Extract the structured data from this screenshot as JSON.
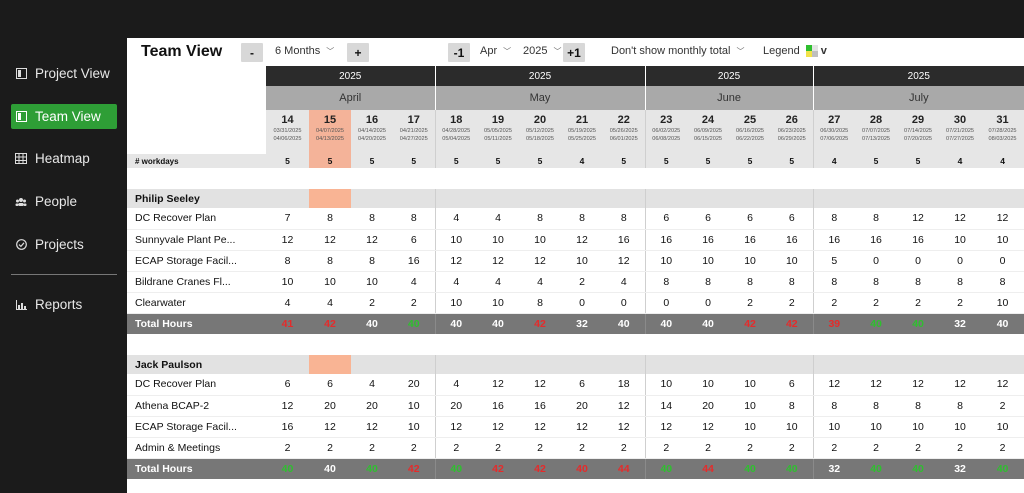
{
  "sidebar": {
    "items": [
      {
        "label": "Project View",
        "icon": "project-icon",
        "active": false
      },
      {
        "label": "Team View",
        "icon": "team-icon",
        "active": true
      },
      {
        "label": "Heatmap",
        "icon": "heatmap-icon",
        "active": false
      },
      {
        "label": "People",
        "icon": "people-icon",
        "active": false
      },
      {
        "label": "Projects",
        "icon": "projects-check-icon",
        "active": false
      },
      {
        "label": "Reports",
        "icon": "chart-icon",
        "active": false
      }
    ]
  },
  "header": {
    "title": "Team View",
    "minus_label": "-",
    "plus_label": "+",
    "range_value": "6 Months",
    "prev_label": "-1",
    "next_label": "+1",
    "month_value": "Apr",
    "year_value": "2025",
    "monthly_total_value": "Don't show monthly total",
    "legend_label": "Legend",
    "legend_chevron": "v",
    "legend_colors": [
      "#2fbf2f",
      "#e3e3e3",
      "#f2e24a",
      "#bfbfbf"
    ]
  },
  "grid": {
    "years": [
      {
        "label": "2025",
        "span": 4
      },
      {
        "label": "2025",
        "span": 5
      },
      {
        "label": "2025",
        "span": 4
      },
      {
        "label": "2025",
        "span": 5
      }
    ],
    "months": [
      {
        "label": "April",
        "span": 4
      },
      {
        "label": "May",
        "span": 5
      },
      {
        "label": "June",
        "span": 4
      },
      {
        "label": "July",
        "span": 5
      }
    ],
    "weeks": [
      {
        "num": "14",
        "start": "03/31/2025",
        "end": "04/06/2025"
      },
      {
        "num": "15",
        "start": "04/07/2025",
        "end": "04/13/2025"
      },
      {
        "num": "16",
        "start": "04/14/2025",
        "end": "04/20/2025"
      },
      {
        "num": "17",
        "start": "04/21/2025",
        "end": "04/27/2025"
      },
      {
        "num": "18",
        "start": "04/28/2025",
        "end": "05/04/2025"
      },
      {
        "num": "19",
        "start": "05/05/2025",
        "end": "05/11/2025"
      },
      {
        "num": "20",
        "start": "05/12/2025",
        "end": "05/18/2025"
      },
      {
        "num": "21",
        "start": "05/19/2025",
        "end": "05/25/2025"
      },
      {
        "num": "22",
        "start": "05/26/2025",
        "end": "06/01/2025"
      },
      {
        "num": "23",
        "start": "06/02/2025",
        "end": "06/08/2025"
      },
      {
        "num": "24",
        "start": "06/09/2025",
        "end": "06/15/2025"
      },
      {
        "num": "25",
        "start": "06/16/2025",
        "end": "06/22/2025"
      },
      {
        "num": "26",
        "start": "06/23/2025",
        "end": "06/29/2025"
      },
      {
        "num": "27",
        "start": "06/30/2025",
        "end": "07/06/2025"
      },
      {
        "num": "28",
        "start": "07/07/2025",
        "end": "07/13/2025"
      },
      {
        "num": "29",
        "start": "07/14/2025",
        "end": "07/20/2025"
      },
      {
        "num": "30",
        "start": "07/21/2025",
        "end": "07/27/2025"
      },
      {
        "num": "31",
        "start": "07/28/2025",
        "end": "08/03/2025"
      }
    ],
    "current_week_index": 1,
    "workdays_label": "# workdays",
    "workdays": [
      "5",
      "5",
      "5",
      "5",
      "5",
      "5",
      "5",
      "4",
      "5",
      "5",
      "5",
      "5",
      "5",
      "4",
      "5",
      "5",
      "4",
      "4"
    ],
    "total_label": "Total Hours",
    "people": [
      {
        "name": "Philip Seeley",
        "projects": [
          {
            "name": "DC Recover Plan",
            "hours": [
              "7",
              "8",
              "8",
              "8",
              "4",
              "4",
              "8",
              "8",
              "8",
              "6",
              "6",
              "6",
              "6",
              "8",
              "8",
              "12",
              "12",
              "12"
            ]
          },
          {
            "name": "Sunnyvale Plant Pe...",
            "hours": [
              "12",
              "12",
              "12",
              "6",
              "10",
              "10",
              "10",
              "12",
              "16",
              "16",
              "16",
              "16",
              "16",
              "16",
              "16",
              "16",
              "10",
              "10"
            ]
          },
          {
            "name": "ECAP Storage Facil...",
            "hours": [
              "8",
              "8",
              "8",
              "16",
              "12",
              "12",
              "12",
              "10",
              "12",
              "10",
              "10",
              "10",
              "10",
              "5",
              "0",
              "0",
              "0",
              "0"
            ]
          },
          {
            "name": "Bildrane Cranes Fl...",
            "hours": [
              "10",
              "10",
              "10",
              "4",
              "4",
              "4",
              "4",
              "2",
              "4",
              "8",
              "8",
              "8",
              "8",
              "8",
              "8",
              "8",
              "8",
              "8"
            ]
          },
          {
            "name": "Clearwater",
            "hours": [
              "4",
              "4",
              "2",
              "2",
              "10",
              "10",
              "8",
              "0",
              "0",
              "0",
              "0",
              "2",
              "2",
              "2",
              "2",
              "2",
              "2",
              "10"
            ]
          }
        ],
        "totals": [
          "41",
          "42",
          "40",
          "40",
          "40",
          "40",
          "42",
          "32",
          "40",
          "40",
          "40",
          "42",
          "42",
          "39",
          "40",
          "40",
          "32",
          "40"
        ],
        "total_status": [
          "red",
          "red",
          "normal",
          "green",
          "normal",
          "normal",
          "red",
          "normal",
          "normal",
          "normal",
          "normal",
          "red",
          "red",
          "red",
          "green",
          "green",
          "normal",
          "normal"
        ]
      },
      {
        "name": "Jack Paulson",
        "projects": [
          {
            "name": "DC Recover Plan",
            "hours": [
              "6",
              "6",
              "4",
              "20",
              "4",
              "12",
              "12",
              "6",
              "18",
              "10",
              "10",
              "10",
              "6",
              "12",
              "12",
              "12",
              "12",
              "12"
            ]
          },
          {
            "name": "Athena BCAP-2",
            "hours": [
              "12",
              "20",
              "20",
              "10",
              "20",
              "16",
              "16",
              "20",
              "12",
              "14",
              "20",
              "10",
              "8",
              "8",
              "8",
              "8",
              "8",
              "2"
            ]
          },
          {
            "name": "ECAP Storage Facil...",
            "hours": [
              "16",
              "12",
              "12",
              "10",
              "12",
              "12",
              "12",
              "12",
              "12",
              "12",
              "12",
              "10",
              "10",
              "10",
              "10",
              "10",
              "10",
              "10"
            ]
          },
          {
            "name": "Admin & Meetings",
            "hours": [
              "2",
              "2",
              "2",
              "2",
              "2",
              "2",
              "2",
              "2",
              "2",
              "2",
              "2",
              "2",
              "2",
              "2",
              "2",
              "2",
              "2",
              "2"
            ]
          }
        ],
        "totals": [
          "40",
          "40",
          "40",
          "42",
          "40",
          "42",
          "42",
          "40",
          "44",
          "40",
          "44",
          "40",
          "40",
          "32",
          "40",
          "40",
          "32",
          "40"
        ],
        "total_status": [
          "green",
          "normal",
          "green",
          "red",
          "green",
          "red",
          "red",
          "red",
          "red",
          "green",
          "red",
          "green",
          "green",
          "normal",
          "green",
          "green",
          "normal",
          "green"
        ]
      }
    ]
  }
}
